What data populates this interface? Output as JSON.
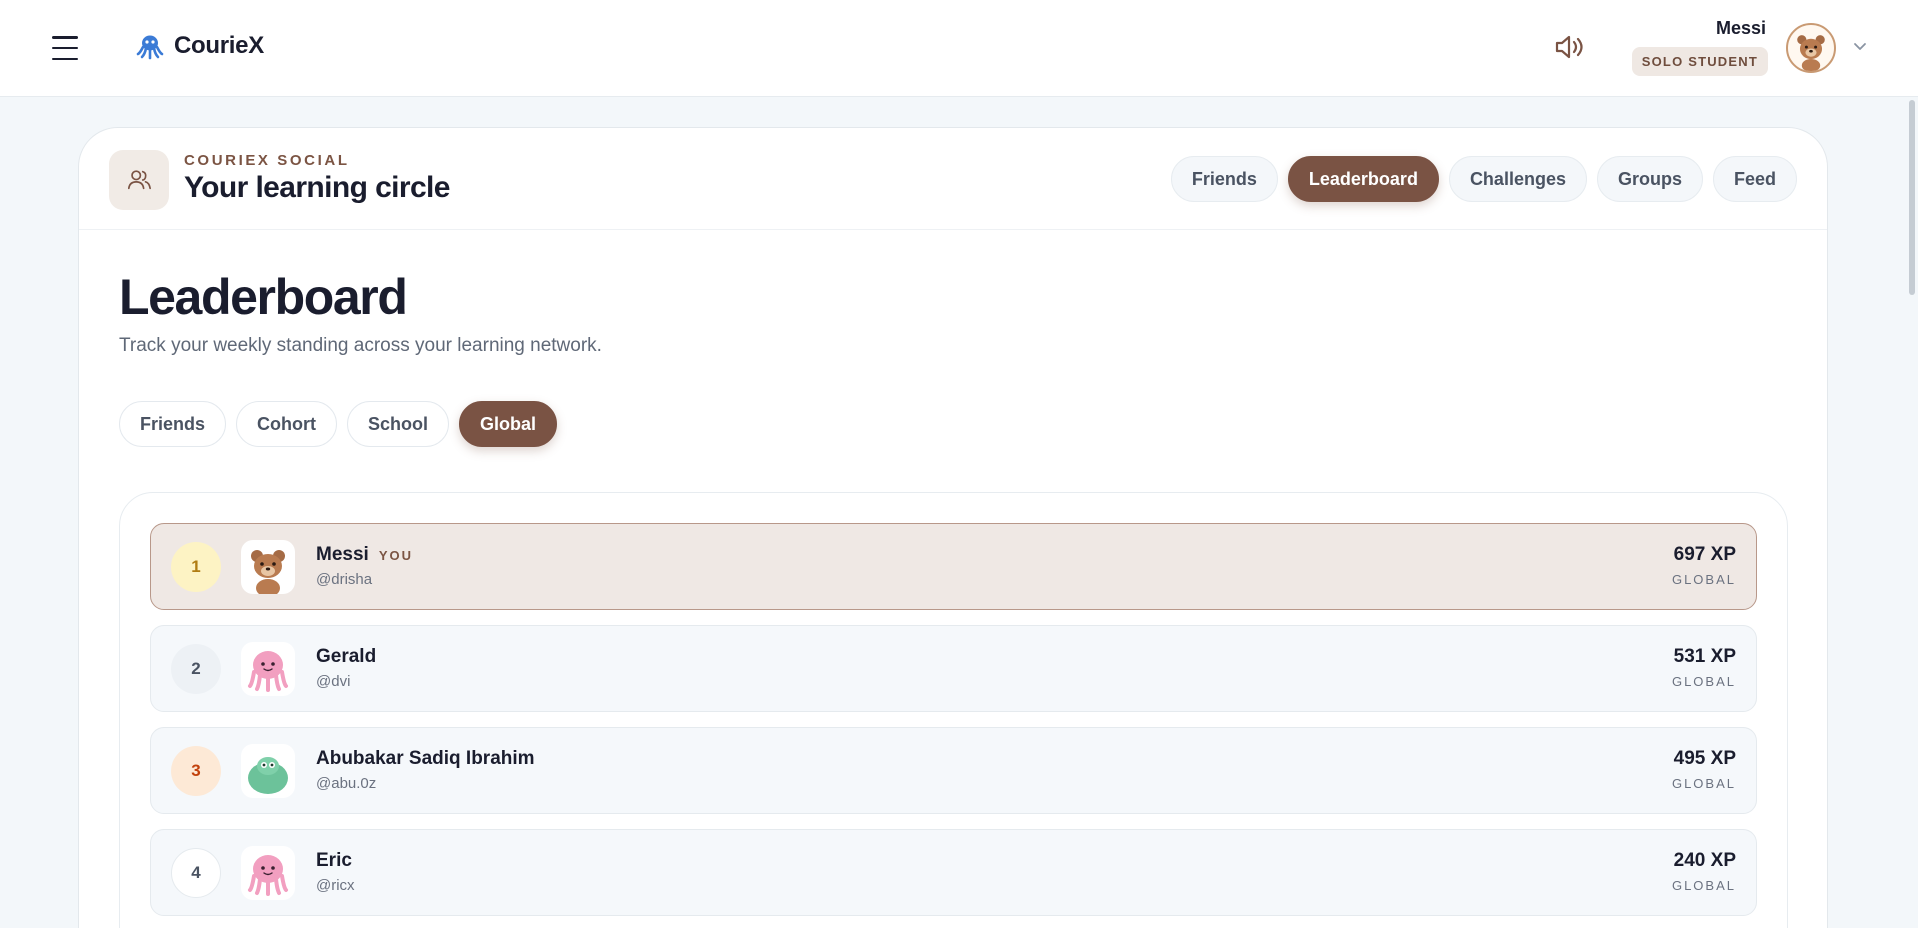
{
  "app": {
    "name": "CourieX"
  },
  "user": {
    "name": "Messi",
    "role_badge": "SOLO STUDENT"
  },
  "social": {
    "kicker": "COURIEX SOCIAL",
    "title": "Your learning circle",
    "tabs": [
      {
        "label": "Friends",
        "active": false
      },
      {
        "label": "Leaderboard",
        "active": true
      },
      {
        "label": "Challenges",
        "active": false
      },
      {
        "label": "Groups",
        "active": false
      },
      {
        "label": "Feed",
        "active": false
      }
    ]
  },
  "leaderboard": {
    "title": "Leaderboard",
    "subtitle": "Track your weekly standing across your learning network.",
    "filters": [
      {
        "label": "Friends",
        "active": false
      },
      {
        "label": "Cohort",
        "active": false
      },
      {
        "label": "School",
        "active": false
      },
      {
        "label": "Global",
        "active": true
      }
    ],
    "rows": [
      {
        "rank": "1",
        "name": "Messi",
        "you_tag": "YOU",
        "handle": "@drisha",
        "xp": "697 XP",
        "scope": "GLOBAL",
        "avatar": "bear",
        "rank_bg": "#fdf3c4",
        "rank_color": "#b07c12"
      },
      {
        "rank": "2",
        "name": "Gerald",
        "you_tag": "",
        "handle": "@dvi",
        "xp": "531 XP",
        "scope": "GLOBAL",
        "avatar": "pink-octopus",
        "rank_bg": "#edf1f5",
        "rank_color": "#4a5362"
      },
      {
        "rank": "3",
        "name": "Abubakar Sadiq Ibrahim",
        "you_tag": "",
        "handle": "@abu.0z",
        "xp": "495 XP",
        "scope": "GLOBAL",
        "avatar": "green-blob",
        "rank_bg": "#fde9d6",
        "rank_color": "#c2410c"
      },
      {
        "rank": "4",
        "name": "Eric",
        "you_tag": "",
        "handle": "@ricx",
        "xp": "240 XP",
        "scope": "GLOBAL",
        "avatar": "pink-octopus",
        "rank_bg": "#ffffff",
        "rank_color": "#4a5362"
      }
    ]
  },
  "colors": {
    "accent": "#7a5344",
    "page_bg": "#f3f7fa"
  }
}
